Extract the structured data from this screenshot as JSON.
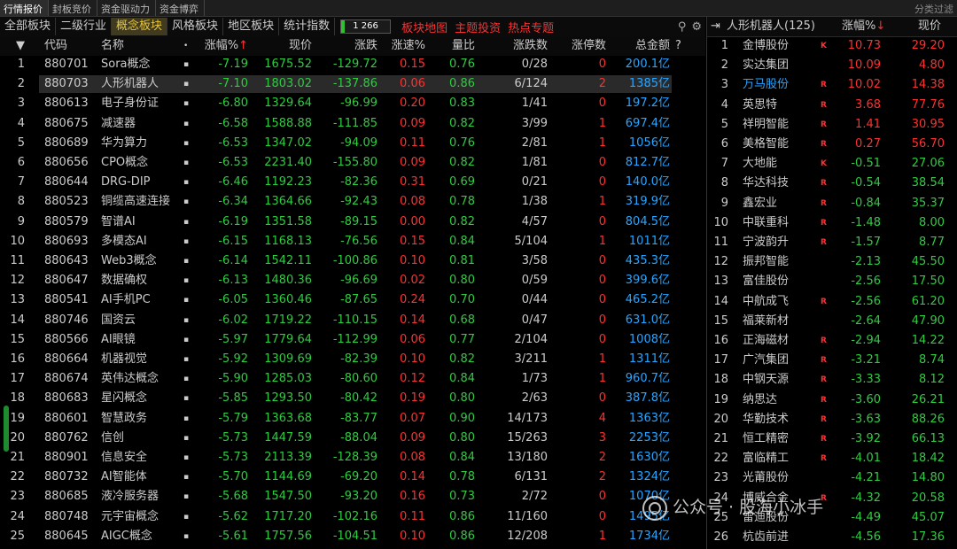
{
  "top_tabs": [
    "行情报价",
    "封板竞价",
    "资金驱动力",
    "资金博弈"
  ],
  "top_right": "分类过滤",
  "sub_tabs": [
    "全部板块",
    "二级行业",
    "概念板块",
    "风格板块",
    "地区板块",
    "统计指数"
  ],
  "sub_active": 2,
  "count": {
    "current": "1",
    "total": "266",
    "fraction": 0.08
  },
  "links": [
    "板块地图",
    "主题投资",
    "热点专题"
  ],
  "icons": [
    "search-icon",
    "gear-icon"
  ],
  "headers": {
    "code": "代码",
    "name": "名称",
    "pct": "涨幅%",
    "price": "现价",
    "chg": "涨跌",
    "speed": "涨速%",
    "ratio": "量比",
    "zd": "涨跌数",
    "zt": "涨停数",
    "amt": "总金额",
    "help": "?"
  },
  "rows": [
    {
      "i": "1",
      "code": "880701",
      "name": "Sora概念",
      "pct": "-7.19",
      "price": "1675.52",
      "chg": "-129.72",
      "speed": "0.15",
      "ratio": "0.76",
      "zd": "0/28",
      "zt": "0",
      "amt": "200.1亿"
    },
    {
      "i": "2",
      "code": "880703",
      "name": "人形机器人",
      "pct": "-7.10",
      "price": "1803.02",
      "chg": "-137.86",
      "speed": "0.06",
      "ratio": "0.86",
      "zd": "6/124",
      "zt": "2",
      "amt": "1385亿"
    },
    {
      "i": "3",
      "code": "880613",
      "name": "电子身份证",
      "pct": "-6.80",
      "price": "1329.64",
      "chg": "-96.99",
      "speed": "0.20",
      "ratio": "0.83",
      "zd": "1/41",
      "zt": "0",
      "amt": "197.2亿"
    },
    {
      "i": "4",
      "code": "880675",
      "name": "减速器",
      "pct": "-6.58",
      "price": "1588.88",
      "chg": "-111.85",
      "speed": "0.09",
      "ratio": "0.82",
      "zd": "3/99",
      "zt": "1",
      "amt": "697.4亿"
    },
    {
      "i": "5",
      "code": "880689",
      "name": "华为算力",
      "pct": "-6.53",
      "price": "1347.02",
      "chg": "-94.09",
      "speed": "0.11",
      "ratio": "0.76",
      "zd": "2/81",
      "zt": "1",
      "amt": "1056亿"
    },
    {
      "i": "6",
      "code": "880656",
      "name": "CPO概念",
      "pct": "-6.53",
      "price": "2231.40",
      "chg": "-155.80",
      "speed": "0.09",
      "ratio": "0.82",
      "zd": "1/81",
      "zt": "0",
      "amt": "812.7亿"
    },
    {
      "i": "7",
      "code": "880644",
      "name": "DRG-DIP",
      "pct": "-6.46",
      "price": "1192.23",
      "chg": "-82.36",
      "speed": "0.31",
      "ratio": "0.69",
      "zd": "0/21",
      "zt": "0",
      "amt": "140.0亿"
    },
    {
      "i": "8",
      "code": "880523",
      "name": "铜缆高速连接",
      "pct": "-6.34",
      "price": "1364.66",
      "chg": "-92.43",
      "speed": "0.08",
      "ratio": "0.78",
      "zd": "1/38",
      "zt": "1",
      "amt": "319.9亿"
    },
    {
      "i": "9",
      "code": "880579",
      "name": "智谱AI",
      "pct": "-6.19",
      "price": "1351.58",
      "chg": "-89.15",
      "speed": "0.00",
      "ratio": "0.82",
      "zd": "4/57",
      "zt": "0",
      "amt": "804.5亿"
    },
    {
      "i": "10",
      "code": "880693",
      "name": "多模态AI",
      "pct": "-6.15",
      "price": "1168.13",
      "chg": "-76.56",
      "speed": "0.15",
      "ratio": "0.84",
      "zd": "5/104",
      "zt": "1",
      "amt": "1011亿"
    },
    {
      "i": "11",
      "code": "880643",
      "name": "Web3概念",
      "pct": "-6.14",
      "price": "1542.11",
      "chg": "-100.86",
      "speed": "0.10",
      "ratio": "0.81",
      "zd": "3/58",
      "zt": "0",
      "amt": "435.3亿"
    },
    {
      "i": "12",
      "code": "880647",
      "name": "数据确权",
      "pct": "-6.13",
      "price": "1480.36",
      "chg": "-96.69",
      "speed": "0.02",
      "ratio": "0.80",
      "zd": "0/59",
      "zt": "0",
      "amt": "399.6亿"
    },
    {
      "i": "13",
      "code": "880541",
      "name": "AI手机PC",
      "pct": "-6.05",
      "price": "1360.46",
      "chg": "-87.65",
      "speed": "0.24",
      "ratio": "0.70",
      "zd": "0/44",
      "zt": "0",
      "amt": "465.2亿"
    },
    {
      "i": "14",
      "code": "880746",
      "name": "国资云",
      "pct": "-6.02",
      "price": "1719.22",
      "chg": "-110.15",
      "speed": "0.14",
      "ratio": "0.68",
      "zd": "0/47",
      "zt": "0",
      "amt": "631.0亿"
    },
    {
      "i": "15",
      "code": "880566",
      "name": "AI眼镜",
      "pct": "-5.97",
      "price": "1779.64",
      "chg": "-112.99",
      "speed": "0.06",
      "ratio": "0.77",
      "zd": "2/104",
      "zt": "0",
      "amt": "1008亿"
    },
    {
      "i": "16",
      "code": "880664",
      "name": "机器视觉",
      "pct": "-5.92",
      "price": "1309.69",
      "chg": "-82.39",
      "speed": "0.10",
      "ratio": "0.82",
      "zd": "3/211",
      "zt": "1",
      "amt": "1311亿"
    },
    {
      "i": "17",
      "code": "880674",
      "name": "英伟达概念",
      "pct": "-5.90",
      "price": "1285.03",
      "chg": "-80.60",
      "speed": "0.12",
      "ratio": "0.84",
      "zd": "1/73",
      "zt": "1",
      "amt": "960.7亿"
    },
    {
      "i": "18",
      "code": "880683",
      "name": "星闪概念",
      "pct": "-5.85",
      "price": "1293.50",
      "chg": "-80.42",
      "speed": "0.19",
      "ratio": "0.80",
      "zd": "2/63",
      "zt": "0",
      "amt": "387.8亿"
    },
    {
      "i": "19",
      "code": "880601",
      "name": "智慧政务",
      "pct": "-5.79",
      "price": "1363.68",
      "chg": "-83.77",
      "speed": "0.07",
      "ratio": "0.90",
      "zd": "14/173",
      "zt": "4",
      "amt": "1363亿"
    },
    {
      "i": "20",
      "code": "880762",
      "name": "信创",
      "pct": "-5.73",
      "price": "1447.59",
      "chg": "-88.04",
      "speed": "0.09",
      "ratio": "0.80",
      "zd": "15/263",
      "zt": "3",
      "amt": "2253亿"
    },
    {
      "i": "21",
      "code": "880901",
      "name": "信息安全",
      "pct": "-5.73",
      "price": "2113.39",
      "chg": "-128.39",
      "speed": "0.08",
      "ratio": "0.84",
      "zd": "13/180",
      "zt": "2",
      "amt": "1630亿"
    },
    {
      "i": "22",
      "code": "880732",
      "name": "AI智能体",
      "pct": "-5.70",
      "price": "1144.69",
      "chg": "-69.20",
      "speed": "0.14",
      "ratio": "0.78",
      "zd": "6/131",
      "zt": "2",
      "amt": "1324亿"
    },
    {
      "i": "23",
      "code": "880685",
      "name": "液冷服务器",
      "pct": "-5.68",
      "price": "1547.50",
      "chg": "-93.20",
      "speed": "0.16",
      "ratio": "0.73",
      "zd": "2/72",
      "zt": "0",
      "amt": "1070亿"
    },
    {
      "i": "24",
      "code": "880748",
      "name": "元宇宙概念",
      "pct": "-5.62",
      "price": "1717.20",
      "chg": "-102.16",
      "speed": "0.11",
      "ratio": "0.86",
      "zd": "11/160",
      "zt": "0",
      "amt": "1495亿"
    },
    {
      "i": "25",
      "code": "880645",
      "name": "AIGC概念",
      "pct": "-5.61",
      "price": "1757.56",
      "chg": "-104.51",
      "speed": "0.10",
      "ratio": "0.86",
      "zd": "12/208",
      "zt": "1",
      "amt": "1734亿"
    }
  ],
  "right_panel": {
    "title": "人形机器人(125)",
    "pct_label": "涨幅%",
    "price_label": "现价",
    "rows": [
      {
        "i": "1",
        "name": "金博股份",
        "flag": "K",
        "pct": "10.73",
        "price": "29.20",
        "up": true
      },
      {
        "i": "2",
        "name": "实达集团",
        "flag": "",
        "pct": "10.09",
        "price": "4.80",
        "up": true
      },
      {
        "i": "3",
        "name": "万马股份",
        "flag": "R",
        "pct": "10.02",
        "price": "14.38",
        "up": true,
        "highlight": true
      },
      {
        "i": "4",
        "name": "英思特",
        "flag": "R",
        "pct": "3.68",
        "price": "77.76",
        "up": true
      },
      {
        "i": "5",
        "name": "祥明智能",
        "flag": "R",
        "pct": "1.41",
        "price": "30.95",
        "up": true
      },
      {
        "i": "6",
        "name": "美格智能",
        "flag": "R",
        "pct": "0.27",
        "price": "56.70",
        "up": true
      },
      {
        "i": "7",
        "name": "大地能",
        "flag": "K",
        "pct": "-0.51",
        "price": "27.06",
        "up": false
      },
      {
        "i": "8",
        "name": "华达科技",
        "flag": "R",
        "pct": "-0.54",
        "price": "38.54",
        "up": false
      },
      {
        "i": "9",
        "name": "鑫宏业",
        "flag": "R",
        "pct": "-0.84",
        "price": "35.37",
        "up": false
      },
      {
        "i": "10",
        "name": "中联重科",
        "flag": "R",
        "pct": "-1.48",
        "price": "8.00",
        "up": false
      },
      {
        "i": "11",
        "name": "宁波韵升",
        "flag": "R",
        "pct": "-1.57",
        "price": "8.77",
        "up": false
      },
      {
        "i": "12",
        "name": "振邦智能",
        "flag": "",
        "pct": "-2.13",
        "price": "45.50",
        "up": false
      },
      {
        "i": "13",
        "name": "富佳股份",
        "flag": "",
        "pct": "-2.56",
        "price": "17.50",
        "up": false
      },
      {
        "i": "14",
        "name": "中航成飞",
        "flag": "R",
        "pct": "-2.56",
        "price": "61.20",
        "up": false
      },
      {
        "i": "15",
        "name": "福莱新材",
        "flag": "",
        "pct": "-2.64",
        "price": "47.90",
        "up": false
      },
      {
        "i": "16",
        "name": "正海磁材",
        "flag": "R",
        "pct": "-2.94",
        "price": "14.22",
        "up": false
      },
      {
        "i": "17",
        "name": "广汽集团",
        "flag": "R",
        "pct": "-3.21",
        "price": "8.74",
        "up": false
      },
      {
        "i": "18",
        "name": "中钢天源",
        "flag": "R",
        "pct": "-3.33",
        "price": "8.12",
        "up": false
      },
      {
        "i": "19",
        "name": "纳思达",
        "flag": "R",
        "pct": "-3.60",
        "price": "26.21",
        "up": false
      },
      {
        "i": "20",
        "name": "华勤技术",
        "flag": "R",
        "pct": "-3.63",
        "price": "88.26",
        "up": false
      },
      {
        "i": "21",
        "name": "恒工精密",
        "flag": "R",
        "pct": "-3.92",
        "price": "66.13",
        "up": false
      },
      {
        "i": "22",
        "name": "富临精工",
        "flag": "R",
        "pct": "-4.01",
        "price": "18.42",
        "up": false
      },
      {
        "i": "23",
        "name": "光莆股份",
        "flag": "",
        "pct": "-4.21",
        "price": "14.80",
        "up": false
      },
      {
        "i": "24",
        "name": "博威合金",
        "flag": "R",
        "pct": "-4.32",
        "price": "20.58",
        "up": false
      },
      {
        "i": "25",
        "name": "雷迪股份",
        "flag": "",
        "pct": "-4.49",
        "price": "45.07",
        "up": false
      },
      {
        "i": "26",
        "name": "杭齿前进",
        "flag": "",
        "pct": "-4.56",
        "price": "17.36",
        "up": false
      }
    ]
  },
  "watermark": "公众号 · 股海小冰手",
  "colors": {
    "up": "#ff3030",
    "down": "#2ecc40",
    "amount": "#2aa5ff",
    "active_tab": "#e8c43a"
  }
}
